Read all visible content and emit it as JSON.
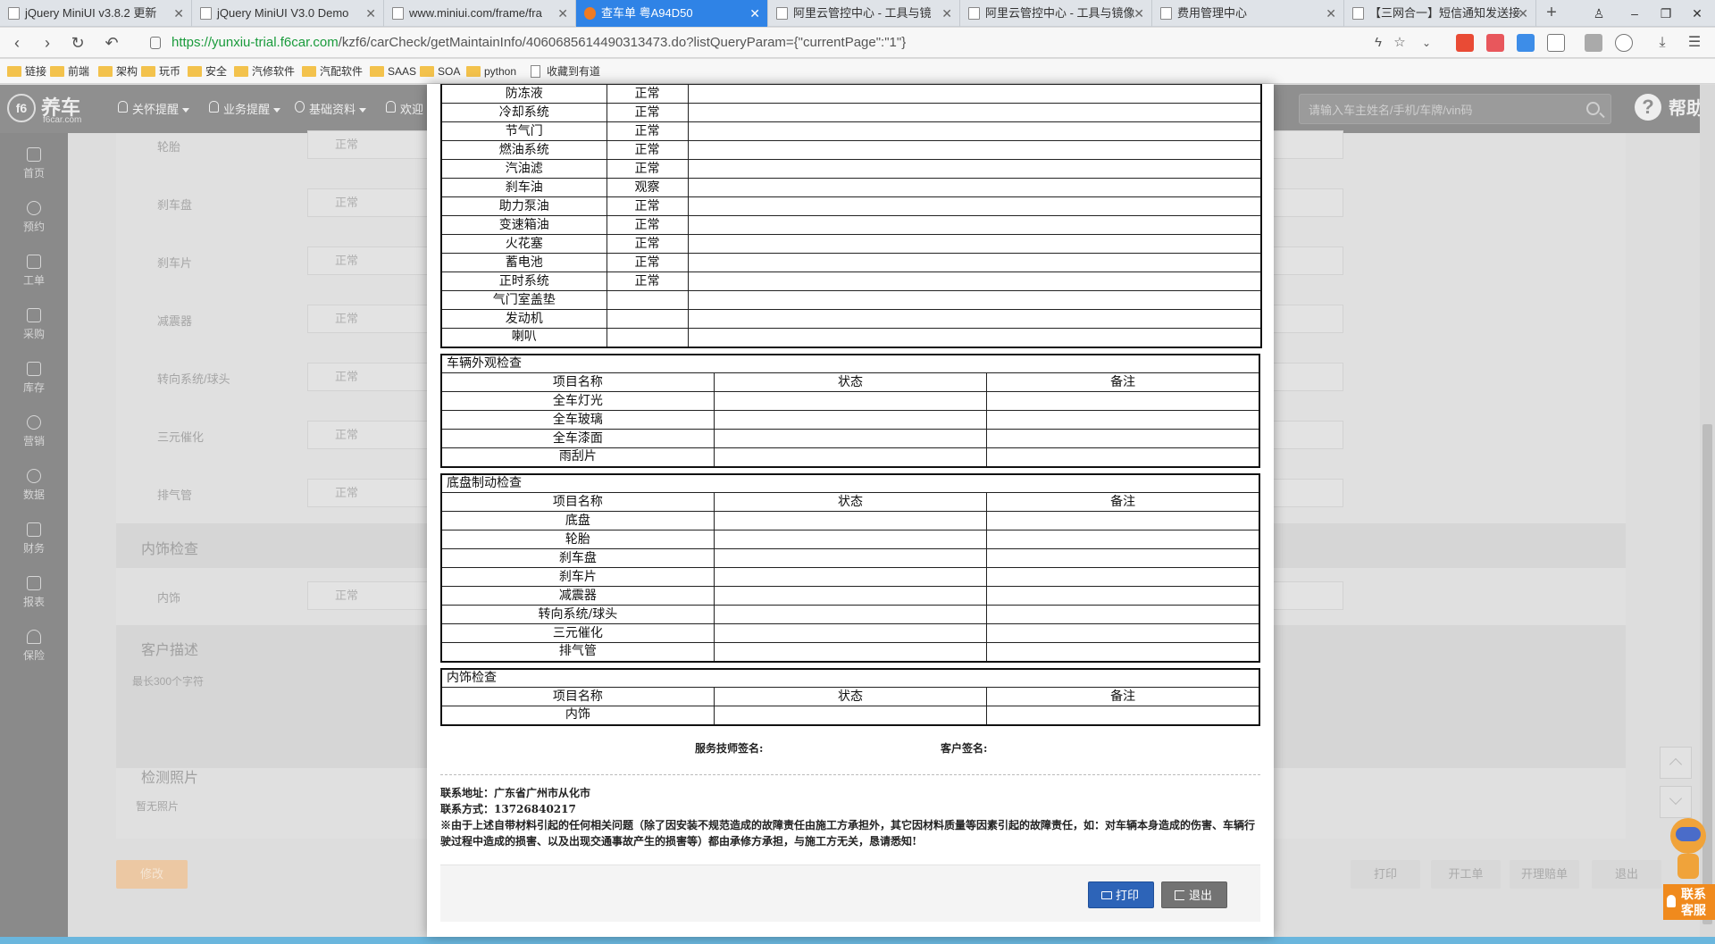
{
  "browser": {
    "tabs": [
      {
        "label": "jQuery MiniUI v3.8.2 更新"
      },
      {
        "label": "jQuery MiniUI V3.0 Demo"
      },
      {
        "label": "www.miniui.com/frame/fra"
      },
      {
        "label": "查车单 粤A94D50"
      },
      {
        "label": "阿里云管控中心 - 工具与镜"
      },
      {
        "label": "阿里云管控中心 - 工具与镜像"
      },
      {
        "label": "费用管理中心"
      },
      {
        "label": "【三网合一】短信通知发送接"
      }
    ],
    "url_secure": "https://yunxiu-trial.f6car.com",
    "url_path": "/kzf6/carCheck/getMaintainInfo/4060685614490313473.do?listQueryParam={\"currentPage\":\"1\"}",
    "bookmarks": [
      "链接",
      "前端",
      "架构",
      "玩币",
      "安全",
      "汽修软件",
      "汽配软件",
      "SAAS",
      "SOA",
      "python",
      "收藏到有道"
    ]
  },
  "header": {
    "logo_text": "养车",
    "logo_sub": "f6car.com",
    "menus": [
      "关怀提醒",
      "业务提醒",
      "基础资料",
      "欢迎"
    ],
    "search_placeholder": "请输入车主姓名/手机/车牌/vin码",
    "help": "帮助"
  },
  "sidebar": [
    "首页",
    "预约",
    "工单",
    "采购",
    "库存",
    "营销",
    "数据",
    "财务",
    "报表",
    "保险"
  ],
  "background_form": {
    "rows": [
      {
        "label": "轮胎",
        "value": "正常"
      },
      {
        "label": "刹车盘",
        "value": "正常"
      },
      {
        "label": "刹车片",
        "value": "正常"
      },
      {
        "label": "减震器",
        "value": "正常"
      },
      {
        "label": "转向系统/球头",
        "value": "正常"
      },
      {
        "label": "三元催化",
        "value": "正常"
      },
      {
        "label": "排气管",
        "value": "正常"
      }
    ],
    "interior_section": "内饰检查",
    "interior_row": {
      "label": "内饰",
      "value": "正常"
    },
    "customer_desc": "客户描述",
    "customer_desc_hint": "最长300个字符",
    "photos": "检测照片",
    "photos_empty": "暂无照片",
    "edit_button": "修改",
    "buttons": [
      "打印",
      "开工单",
      "开理赔单",
      "退出"
    ]
  },
  "report": {
    "engine_rows": [
      {
        "name": "防冻液",
        "status": "正常"
      },
      {
        "name": "冷却系统",
        "status": "正常"
      },
      {
        "name": "节气门",
        "status": "正常"
      },
      {
        "name": "燃油系统",
        "status": "正常"
      },
      {
        "name": "汽油滤",
        "status": "正常"
      },
      {
        "name": "刹车油",
        "status": "观察"
      },
      {
        "name": "助力泵油",
        "status": "正常"
      },
      {
        "name": "变速箱油",
        "status": "正常"
      },
      {
        "name": "火花塞",
        "status": "正常"
      },
      {
        "name": "蓄电池",
        "status": "正常"
      },
      {
        "name": "正时系统",
        "status": "正常"
      },
      {
        "name": "气门室盖垫",
        "status": ""
      },
      {
        "name": "发动机",
        "status": ""
      },
      {
        "name": "喇叭",
        "status": ""
      }
    ],
    "col_name": "项目名称",
    "col_status": "状态",
    "col_note": "备注",
    "exterior": {
      "title": "车辆外观检查",
      "rows": [
        "全车灯光",
        "全车玻璃",
        "全车漆面",
        "雨刮片"
      ]
    },
    "chassis": {
      "title": "底盘制动检查",
      "rows": [
        "底盘",
        "轮胎",
        "刹车盘",
        "刹车片",
        "减震器",
        "转向系统/球头",
        "三元催化",
        "排气管"
      ]
    },
    "interior": {
      "title": "内饰检查",
      "rows": [
        "内饰"
      ]
    },
    "tech_sign": "服务技师签名:",
    "customer_sign": "客户签名:",
    "address": "联系地址：广东省广州市从化市",
    "phone": "联系方式：13726840217",
    "disclaimer": "※由于上述自带材料引起的任何相关问题（除了因安装不规范造成的故障责任由施工方承担外，其它因材料质量等因素引起的故障责任，如：对车辆本身造成的伤害、车辆行驶过程中造成的损害、以及出现交通事故产生的损害等）都由承修方承担，与施工方无关，恳请悉知!",
    "print_button": "打印",
    "exit_button": "退出"
  },
  "contact": {
    "line1": "联系",
    "line2": "客服"
  }
}
